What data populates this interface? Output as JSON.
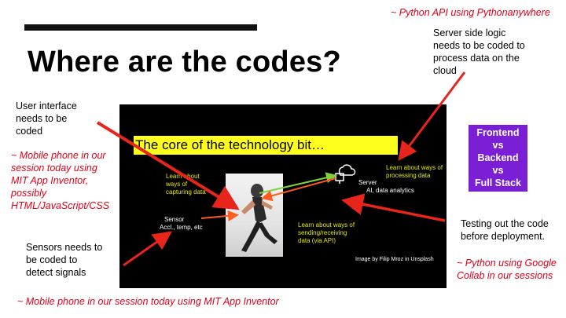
{
  "slide": {
    "title": "Where are the codes?",
    "top_right_note": "~ Python API using Pythonanywhere",
    "server_note": [
      "Server side logic",
      "needs to be coded to",
      "process data on the",
      "cloud"
    ],
    "ui_note": [
      "User interface",
      "needs to be",
      "coded"
    ],
    "ui_detail": [
      "~ Mobile phone in our",
      "session today using",
      "MIT App Inventor,",
      "possibly",
      "HTML/JavaScript/CSS"
    ],
    "sensor_note": [
      "Sensors needs to",
      "be coded to",
      "detect signals"
    ],
    "bottom_note": "~ Mobile phone in our session today using MIT App Inventor",
    "testing_note": [
      "Testing out the code",
      "before deployment."
    ],
    "testing_detail": [
      "~ Python using Google",
      "Collab in our sessions"
    ],
    "stack_box": [
      "Frontend",
      "vs",
      "Backend",
      "vs",
      "Full Stack"
    ]
  },
  "embedded_image": {
    "banner": "The core of the technology bit…",
    "capture_label": [
      "Learn about",
      "ways of",
      "capturing data"
    ],
    "sensor_label": [
      "Sensor",
      "Accl., temp, etc"
    ],
    "processing_label": [
      "Learn about ways of",
      "processing data"
    ],
    "server_label": [
      "Server",
      "AI, data analytics"
    ],
    "sending_label": [
      "Learn about ways of",
      "sending/receiving",
      "data (via API)"
    ],
    "credit": "Image by Filip Mroz in Unsplash"
  },
  "colors": {
    "accent_red": "#e0001a",
    "stack_purple": "#7a1fd6",
    "banner_yellow": "#ffff1e"
  }
}
